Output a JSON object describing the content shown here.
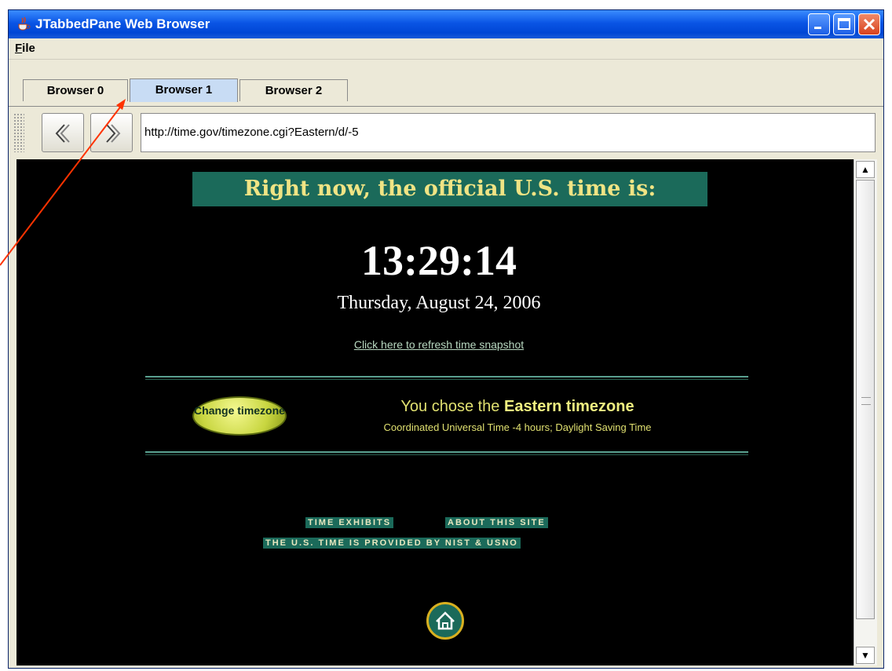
{
  "window": {
    "title": "JTabbedPane Web Browser"
  },
  "menubar": {
    "file_label": "File"
  },
  "tabs": [
    {
      "label": "Browser 0",
      "selected": false
    },
    {
      "label": "Browser 1",
      "selected": true
    },
    {
      "label": "Browser 2",
      "selected": false
    }
  ],
  "toolbar": {
    "back_icon": "double-chevron-left-icon",
    "forward_icon": "double-chevron-right-icon",
    "url": "http://time.gov/timezone.cgi?Eastern/d/-5"
  },
  "page": {
    "headline": "Right now, the official U.S. time is:",
    "time": "13:29:14",
    "date": "Thursday, August 24, 2006",
    "refresh_link": "Click here to refresh time snapshot",
    "change_button": "Change timezone",
    "tz_prefix": "You chose the",
    "tz_name": "Eastern timezone",
    "tz_detail": "Coordinated Universal Time -4 hours; Daylight Saving Time",
    "link_exhibits": "Time Exhibits",
    "link_about": "About this site",
    "provided_by": "The U.S. time is provided by NIST & USNO"
  },
  "colors": {
    "titlebar": "#0a55e5",
    "headline_bg": "#1b6a5a",
    "headline_text": "#f0e484",
    "annotation_arrow": "#ff3300"
  }
}
